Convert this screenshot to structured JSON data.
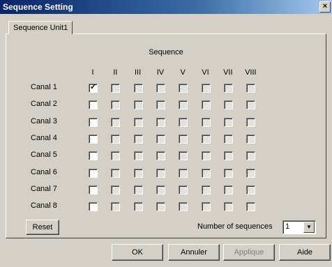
{
  "window": {
    "title": "Sequence Setting",
    "close_glyph": "×"
  },
  "tab": {
    "label": "Sequence Unit1"
  },
  "group_title": "Sequence",
  "columns": [
    "I",
    "II",
    "III",
    "IV",
    "V",
    "VI",
    "VII",
    "VIII"
  ],
  "rows": [
    {
      "label": "Canal 1",
      "checked": [
        true,
        false,
        false,
        false,
        false,
        false,
        false,
        false
      ]
    },
    {
      "label": "Canal 2",
      "checked": [
        false,
        false,
        false,
        false,
        false,
        false,
        false,
        false
      ]
    },
    {
      "label": "Canal 3",
      "checked": [
        false,
        false,
        false,
        false,
        false,
        false,
        false,
        false
      ]
    },
    {
      "label": "Canal 4",
      "checked": [
        false,
        false,
        false,
        false,
        false,
        false,
        false,
        false
      ]
    },
    {
      "label": "Canal 5",
      "checked": [
        false,
        false,
        false,
        false,
        false,
        false,
        false,
        false
      ]
    },
    {
      "label": "Canal 6",
      "checked": [
        false,
        false,
        false,
        false,
        false,
        false,
        false,
        false
      ]
    },
    {
      "label": "Canal 7",
      "checked": [
        false,
        false,
        false,
        false,
        false,
        false,
        false,
        false
      ]
    },
    {
      "label": "Canal 8",
      "checked": [
        false,
        false,
        false,
        false,
        false,
        false,
        false,
        false
      ]
    }
  ],
  "number_of_sequences": {
    "label": "Number of sequences",
    "value": "1"
  },
  "buttons": {
    "reset": "Reset",
    "ok": "OK",
    "cancel": "Annuler",
    "apply": "Applique",
    "help": "Aide"
  }
}
